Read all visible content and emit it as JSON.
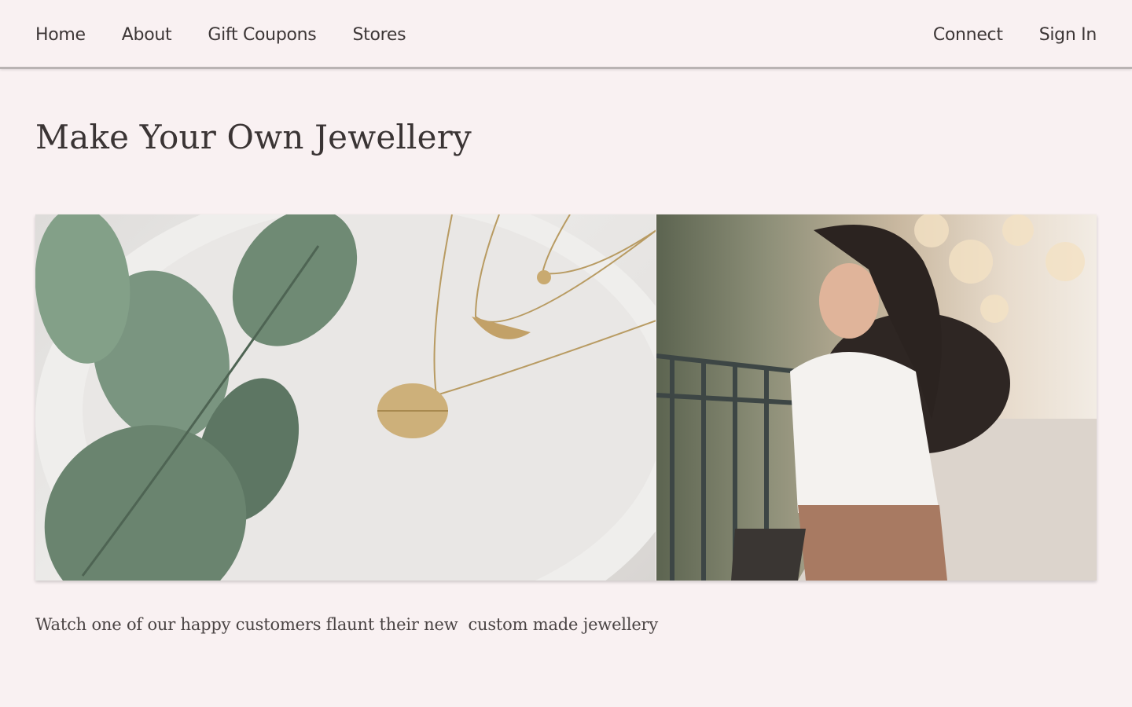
{
  "nav": {
    "left": [
      {
        "label": "Home"
      },
      {
        "label": "About"
      },
      {
        "label": "Gift Coupons"
      },
      {
        "label": "Stores"
      }
    ],
    "right": [
      {
        "label": "Connect"
      },
      {
        "label": "Sign In"
      }
    ]
  },
  "main": {
    "title": "Make Your Own Jewellery",
    "gallery": [
      {
        "name": "necklace-photo"
      },
      {
        "name": "customer-photo"
      }
    ],
    "caption": "Watch one of our happy customers flaunt their new  custom made jewellery"
  },
  "colors": {
    "background": "#f9f1f2",
    "text": "#3a3434",
    "nav_border": "#b9b3b3"
  }
}
